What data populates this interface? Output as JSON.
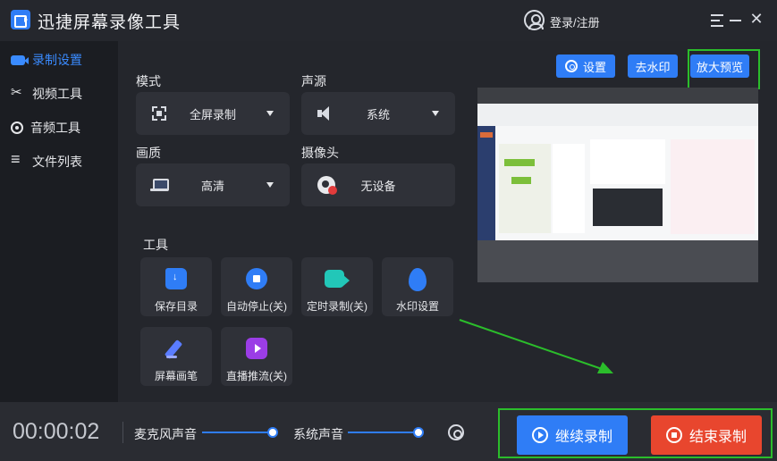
{
  "app": {
    "title": "迅捷屏幕录像工具"
  },
  "header": {
    "login_label": "登录/注册"
  },
  "sidebar": {
    "items": [
      {
        "label": "录制设置",
        "icon": "video-camera-icon",
        "active": true
      },
      {
        "label": "视频工具",
        "icon": "scissors-icon",
        "active": false
      },
      {
        "label": "音频工具",
        "icon": "audio-icon",
        "active": false
      },
      {
        "label": "文件列表",
        "icon": "list-icon",
        "active": false
      }
    ]
  },
  "settings": {
    "mode": {
      "label": "模式",
      "value": "全屏录制"
    },
    "audio_source": {
      "label": "声源",
      "value": "系统"
    },
    "quality": {
      "label": "画质",
      "value": "高清"
    },
    "camera": {
      "label": "摄像头",
      "value": "无设备"
    }
  },
  "tools": {
    "label": "工具",
    "items": [
      {
        "label": "保存目录",
        "icon": "folder-icon"
      },
      {
        "label": "自动停止(关)",
        "icon": "stop-icon"
      },
      {
        "label": "定时录制(关)",
        "icon": "timer-camera-icon"
      },
      {
        "label": "水印设置",
        "icon": "watermark-drop-icon"
      },
      {
        "label": "屏幕画笔",
        "icon": "pen-icon"
      },
      {
        "label": "直播推流(关)",
        "icon": "live-tv-icon"
      }
    ]
  },
  "top_actions": {
    "settings_label": "设置",
    "remove_watermark_label": "去水印",
    "zoom_preview_label": "放大预览"
  },
  "bottom": {
    "timer": "00:00:02",
    "mic_label": "麦克风声音",
    "system_label": "系统声音",
    "mic_volume": 1.0,
    "system_volume": 1.0,
    "continue_label": "继续录制",
    "stop_label": "结束录制"
  },
  "colors": {
    "accent": "#2f7df6",
    "stop": "#e8462e",
    "highlight": "#2bbd2b",
    "background": "#24262c"
  }
}
